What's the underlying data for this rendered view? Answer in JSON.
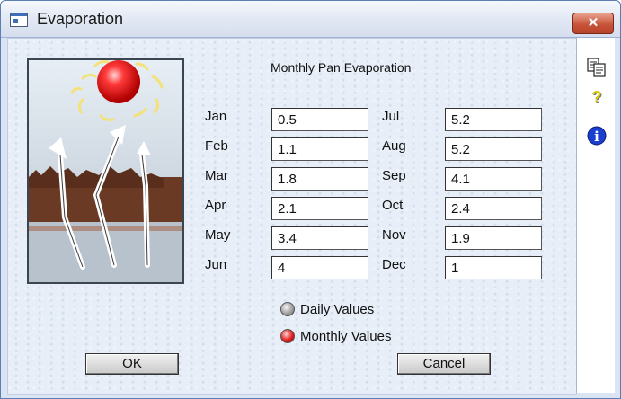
{
  "window": {
    "title": "Evaporation",
    "close_glyph": "✕"
  },
  "heading": "Monthly Pan Evaporation",
  "months_left": [
    {
      "label": "Jan",
      "value": "0.5"
    },
    {
      "label": "Feb",
      "value": "1.1"
    },
    {
      "label": "Mar",
      "value": "1.8"
    },
    {
      "label": "Apr",
      "value": "2.1"
    },
    {
      "label": "May",
      "value": "3.4"
    },
    {
      "label": "Jun",
      "value": "4"
    }
  ],
  "months_right": [
    {
      "label": "Jul",
      "value": "5.2"
    },
    {
      "label": "Aug",
      "value": "5.2"
    },
    {
      "label": "Sep",
      "value": "4.1"
    },
    {
      "label": "Oct",
      "value": "2.4"
    },
    {
      "label": "Nov",
      "value": "1.9"
    },
    {
      "label": "Dec",
      "value": "1"
    }
  ],
  "options": {
    "daily_label": "Daily Values",
    "monthly_label": "Monthly Values",
    "selected": "monthly"
  },
  "buttons": {
    "ok": "OK",
    "cancel": "Cancel"
  },
  "sidebar_icons": [
    "copy-icon",
    "help-icon",
    "info-icon"
  ],
  "icon_glyphs": {
    "help": "?",
    "info": "i"
  },
  "colors": {
    "close_red": "#c8553a",
    "radio_selected": "#e02020",
    "info_blue": "#1a3fd0",
    "help_yellow": "#d8c800"
  }
}
